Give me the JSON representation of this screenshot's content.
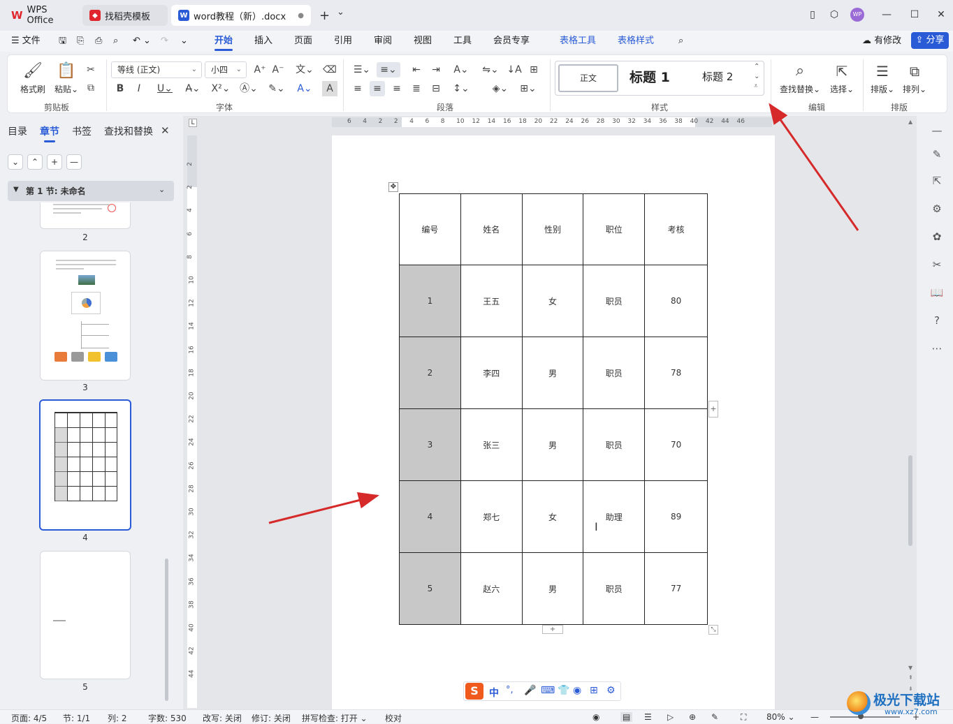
{
  "tabs": {
    "wps": "WPS Office",
    "template": "找稻壳模板",
    "doc": "word教程（新）.docx",
    "add": "+",
    "dropdown": "⌄"
  },
  "window": {
    "avatar": "WP",
    "minimize": "—",
    "maximize": "☐",
    "close": "✕"
  },
  "menu": {
    "file": "文件",
    "items": [
      "开始",
      "插入",
      "页面",
      "引用",
      "审阅",
      "视图",
      "工具",
      "会员专享"
    ],
    "table_tools": "表格工具",
    "table_style": "表格样式",
    "modified": "有修改",
    "share": "分享"
  },
  "ribbon": {
    "clipboard": {
      "format_painter": "格式刷",
      "paste": "粘贴",
      "label": "剪贴板"
    },
    "font": {
      "name": "等线 (正文)",
      "size": "小四",
      "label": "字体"
    },
    "paragraph": {
      "label": "段落"
    },
    "styles": {
      "normal": "正文",
      "h1": "标题 1",
      "h2": "标题 2",
      "label": "样式"
    },
    "edit": {
      "find_replace": "查找替换",
      "select": "选择",
      "label": "编辑"
    },
    "arrange": {
      "layout": "排版",
      "order": "排列",
      "label": "排版"
    }
  },
  "nav_panel": {
    "tabs": [
      "目录",
      "章节",
      "书签",
      "查找和替换"
    ],
    "section": "第 1 节: 未命名",
    "pages": [
      "2",
      "3",
      "4",
      "5"
    ]
  },
  "ruler": {
    "h_ticks": [
      "6",
      "4",
      "2",
      "2",
      "4",
      "6",
      "8",
      "10",
      "12",
      "14",
      "16",
      "18",
      "20",
      "22",
      "24",
      "26",
      "28",
      "30",
      "32",
      "34",
      "36",
      "38",
      "40",
      "42",
      "44",
      "46"
    ],
    "v_ticks": [
      "2",
      "2",
      "4",
      "6",
      "8",
      "10",
      "12",
      "14",
      "16",
      "18",
      "20",
      "22",
      "24",
      "26",
      "28",
      "30",
      "32",
      "34",
      "36",
      "38",
      "40",
      "42",
      "44"
    ]
  },
  "table": {
    "headers": [
      "编号",
      "姓名",
      "性别",
      "职位",
      "考核"
    ],
    "rows": [
      [
        "1",
        "王五",
        "女",
        "职员",
        "80"
      ],
      [
        "2",
        "李四",
        "男",
        "职员",
        "78"
      ],
      [
        "3",
        "张三",
        "男",
        "职员",
        "70"
      ],
      [
        "4",
        "郑七",
        "女",
        "助理",
        "89"
      ],
      [
        "5",
        "赵六",
        "男",
        "职员",
        "77"
      ]
    ]
  },
  "status": {
    "page": "页面: 4/5",
    "section": "节: 1/1",
    "column": "列: 2",
    "words": "字数: 530",
    "rewrite": "改写: 关闭",
    "revise": "修订: 关闭",
    "spell": "拼写检查: 打开",
    "proof": "校对",
    "zoom": "80%"
  },
  "ime": {
    "lang": "中"
  },
  "watermark": {
    "brand": "极光下载站",
    "url": "www.xz7.com"
  },
  "colors": {
    "accent": "#2a5bd7",
    "arrow": "#d62a2a",
    "selected_cell": "#c8c8c8"
  }
}
